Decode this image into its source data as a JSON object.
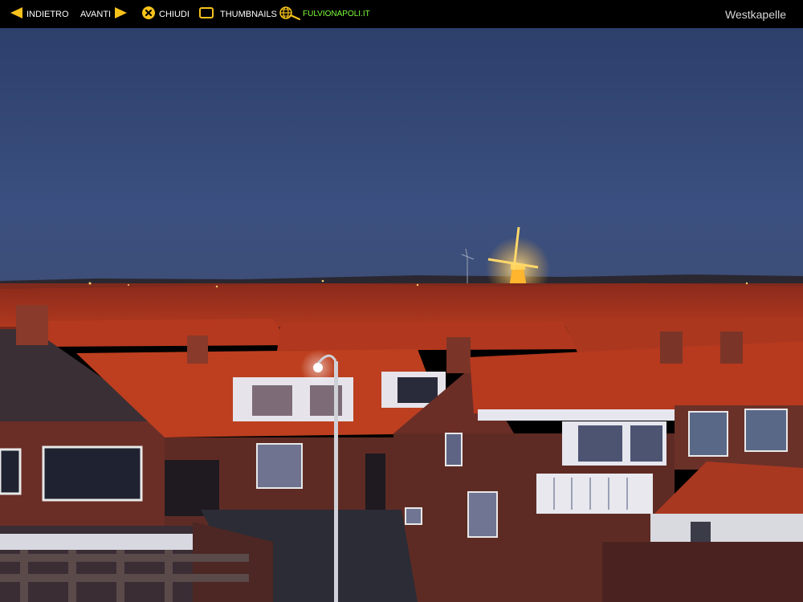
{
  "toolbar": {
    "back_label": "INDIETRO",
    "forward_label": "AVANTI",
    "close_label": "CHIUDI",
    "thumbnails_label": "THUMBNAILS",
    "site_label": "FULVIONAPOLI.IT",
    "accent_color": "#f7c21b",
    "site_color": "#7cff3a"
  },
  "photo": {
    "title": "Westkapelle"
  }
}
